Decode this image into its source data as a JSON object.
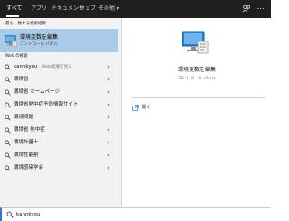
{
  "tabs": [
    {
      "label": "すべて"
    },
    {
      "label": "アプリ"
    },
    {
      "label": "ドキュメント"
    },
    {
      "label": "ウェブ"
    },
    {
      "label": "その他"
    }
  ],
  "top_icons": [
    "feedback-icon",
    "more-icon"
  ],
  "best_match": {
    "heading": "最も一致する検索結果",
    "title": "環境変数を編集",
    "subtitle": "コントロール パネル"
  },
  "web": {
    "heading": "Web の検索",
    "items": [
      {
        "text": "kannkyou",
        "hint": " - Web 結果を見る"
      },
      {
        "text": "環境省",
        "hint": ""
      },
      {
        "text": "環境省 ホームページ",
        "hint": ""
      },
      {
        "text": "環境省熱中症予防情報サイト",
        "hint": ""
      },
      {
        "text": "環境問題",
        "hint": ""
      },
      {
        "text": "環境省 熱中症",
        "hint": ""
      },
      {
        "text": "環境計量士",
        "hint": ""
      },
      {
        "text": "環境性能割",
        "hint": ""
      },
      {
        "text": "環境感染学会",
        "hint": ""
      }
    ]
  },
  "detail": {
    "title": "環境変数を編集",
    "subtitle": "コントロール パネル",
    "action_open": "開く"
  },
  "search": {
    "value": "kannkyou"
  },
  "colors": {
    "top_bar": "#1f1f1f",
    "selected": "#a9cbe8",
    "accent": "#2d7bd0",
    "pane_bg": "#f2f2f2"
  }
}
